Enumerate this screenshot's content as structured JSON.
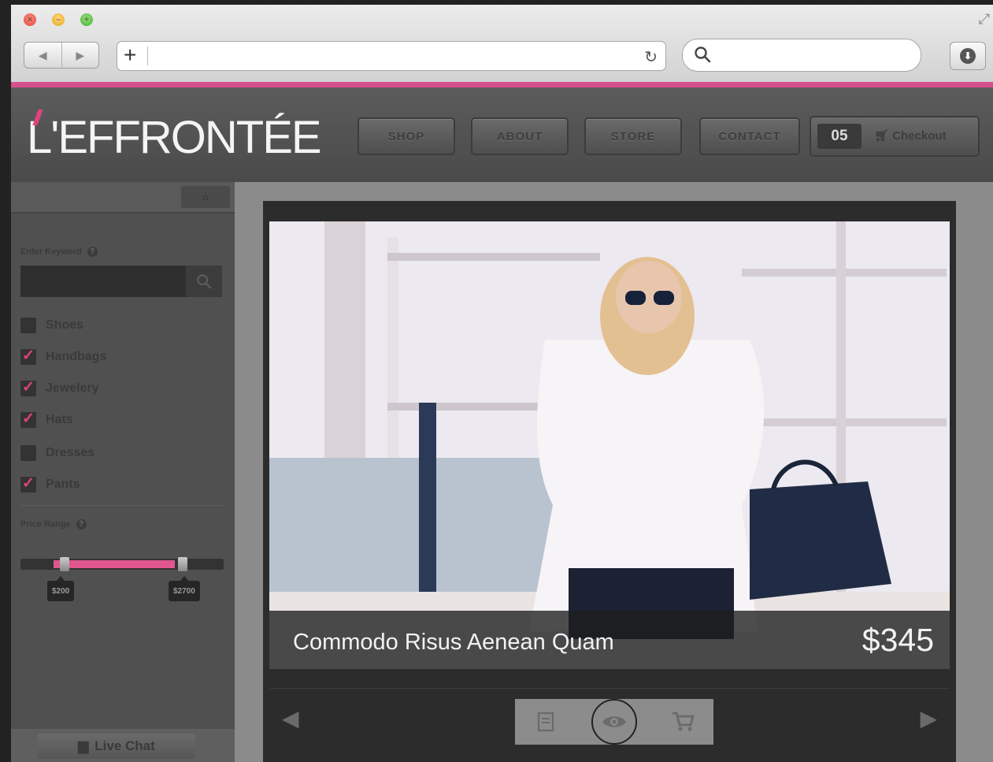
{
  "browser": {
    "url": "",
    "search_query": ""
  },
  "site": {
    "logo": "L'EFFRONTÉE",
    "nav": [
      "SHOP",
      "ABOUT",
      "STORE",
      "CONTACT"
    ],
    "cart_count": "05",
    "checkout_label": "Checkout",
    "accent_color": "#d84f8e"
  },
  "sidebar": {
    "collapse_label": "",
    "keyword_label": "Enter Keyword",
    "keyword_value": "",
    "categories": [
      {
        "label": "Shoes",
        "checked": false
      },
      {
        "label": "Handbags",
        "checked": true
      },
      {
        "label": "Jewelery",
        "checked": true
      },
      {
        "label": "Hats",
        "checked": true
      },
      {
        "label": "Dresses",
        "checked": false
      },
      {
        "label": "Pants",
        "checked": true
      }
    ],
    "price_range_label": "Price Range",
    "price_min": "$200",
    "price_max": "$2700",
    "live_chat_label": "Live Chat"
  },
  "product": {
    "title": "Commodo Risus Aenean Quam",
    "price": "$345"
  },
  "icons": {
    "back": "chevron-left-icon",
    "forward": "chevron-right-icon",
    "new_tab": "plus-icon",
    "reload": "reload-icon",
    "search": "search-icon",
    "downloads": "download-icon",
    "cart": "cart-icon",
    "view": "eye-icon",
    "details": "document-icon"
  }
}
